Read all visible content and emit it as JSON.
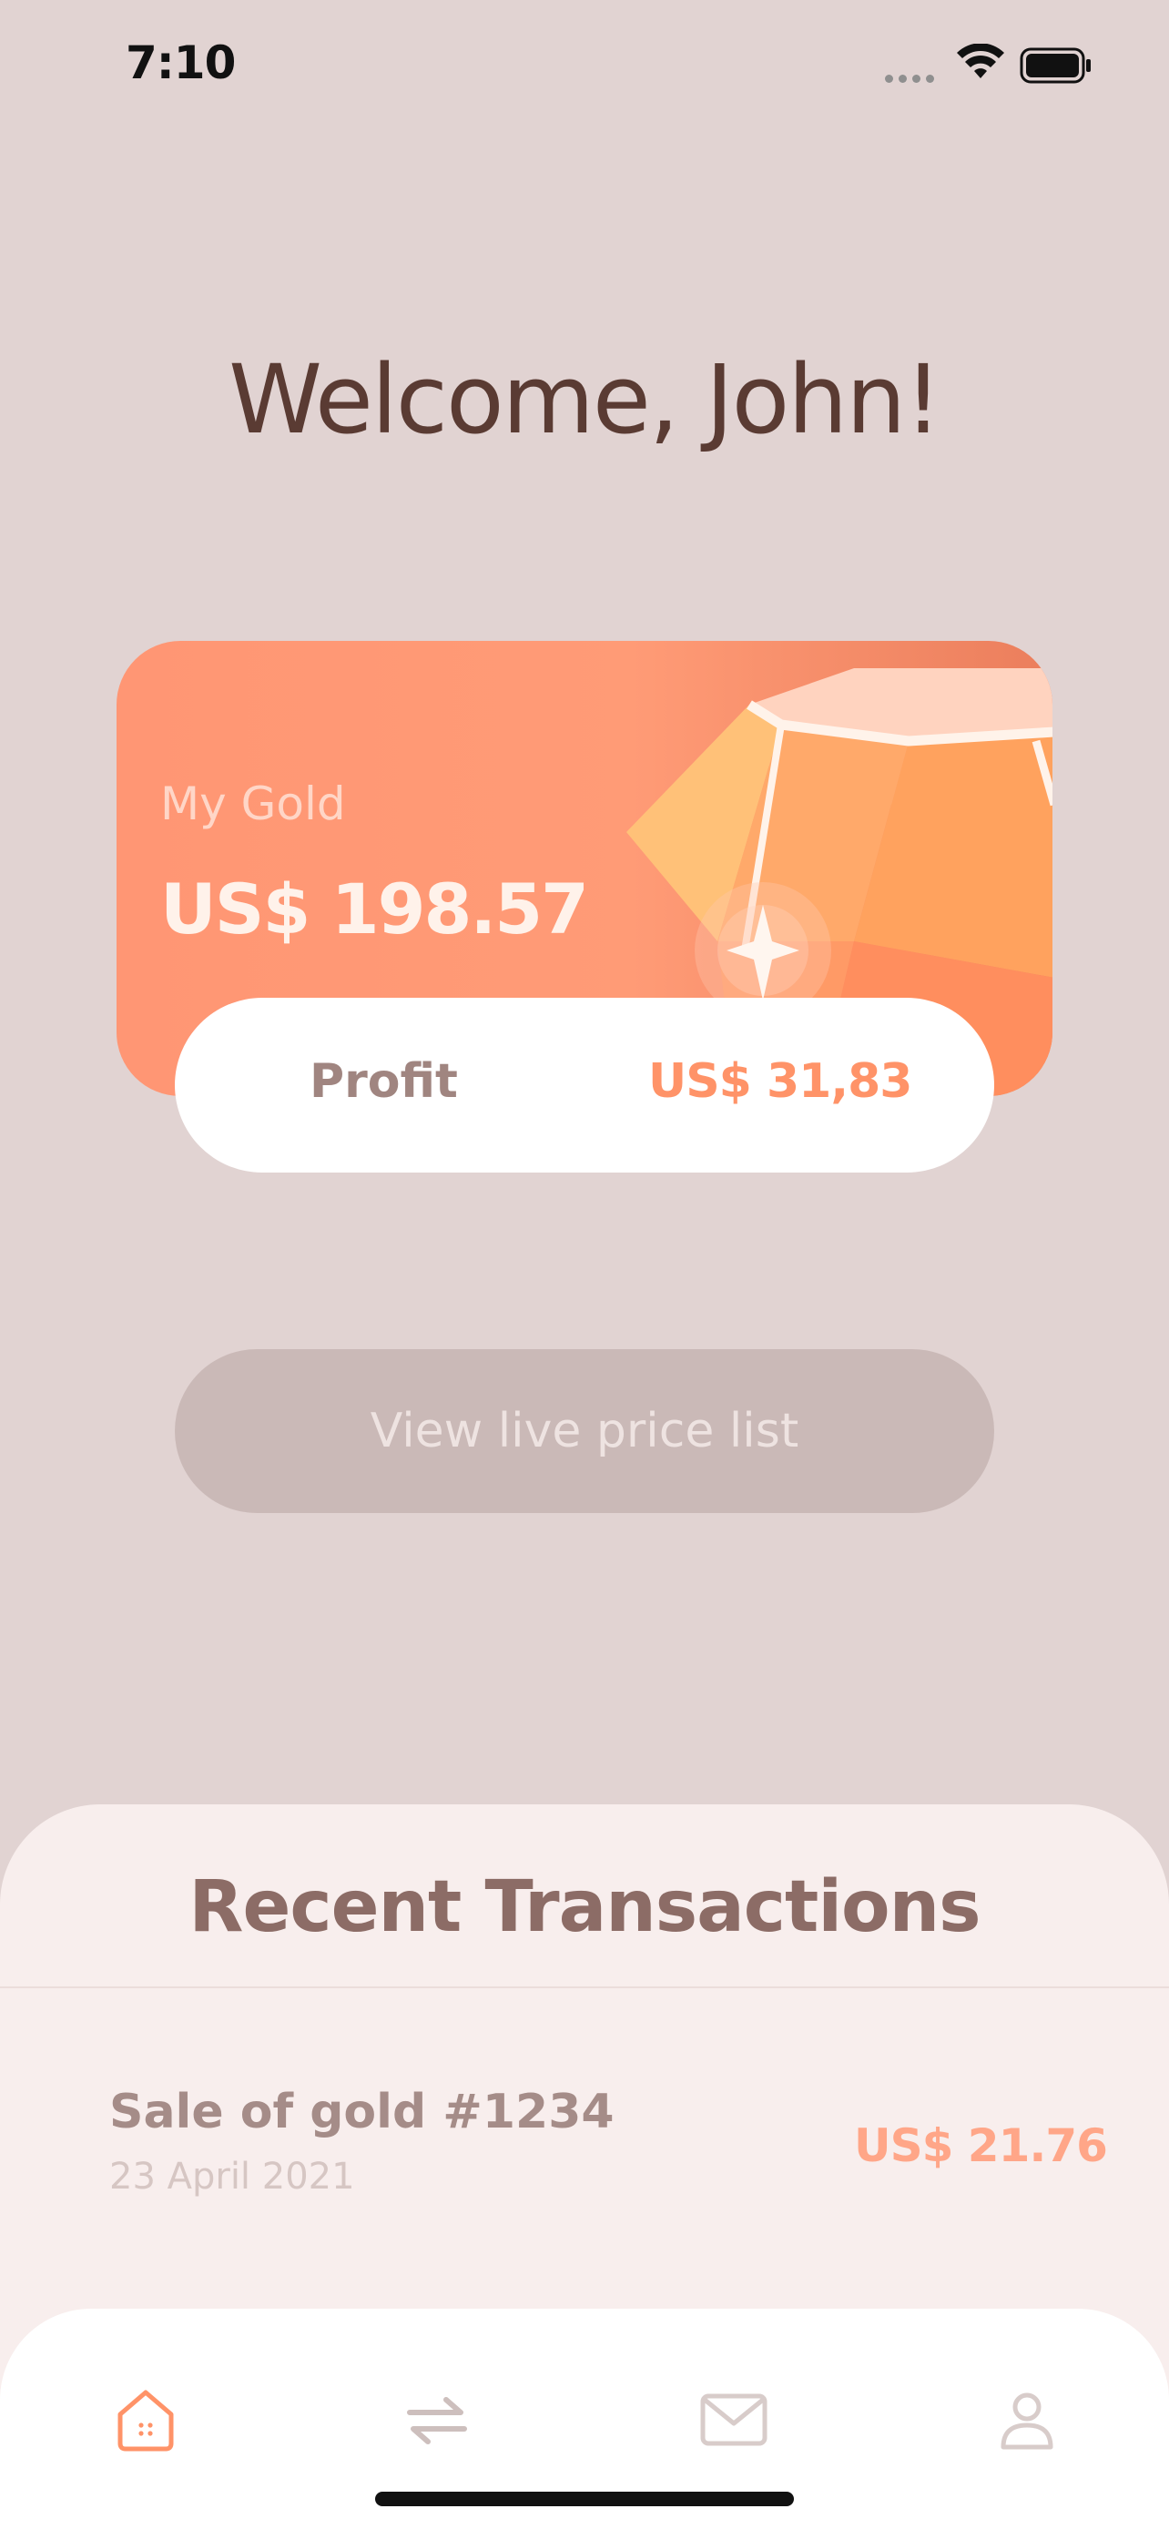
{
  "status_bar": {
    "time": "7:10"
  },
  "welcome": {
    "title": "Welcome, John!"
  },
  "gold_card": {
    "label": "My Gold",
    "value": "US$ 198.57"
  },
  "profit": {
    "label": "Profit",
    "value": "US$ 31,83"
  },
  "live_price_button": {
    "label": "View live price list"
  },
  "recent_transactions": {
    "title": "Recent Transactions",
    "items": [
      {
        "title": "Sale of gold #1234",
        "date": "23 April 2021",
        "amount": "US$ 21.76"
      }
    ]
  },
  "tab_bar": {
    "tabs": [
      {
        "icon": "home-icon",
        "active": true
      },
      {
        "icon": "transfer-icon",
        "active": false
      },
      {
        "icon": "mail-icon",
        "active": false
      },
      {
        "icon": "profile-icon",
        "active": false
      }
    ]
  },
  "colors": {
    "background": "#E1D3D2",
    "accent": "#FF9368",
    "card": "#FF9674",
    "heading": "#5A3B33",
    "sheet": "#F8EEED",
    "button": "#CAB9B7"
  }
}
